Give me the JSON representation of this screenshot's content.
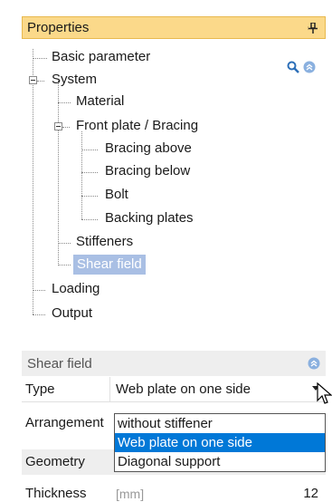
{
  "panel": {
    "title": "Properties",
    "pin_icon": "pin-icon"
  },
  "toolbar": {
    "search_icon": "search-icon",
    "collapse_icon": "collapse-up-icon"
  },
  "tree": {
    "basic_parameter": "Basic parameter",
    "system": "System",
    "material": "Material",
    "front_plate": "Front plate / Bracing",
    "bracing_above": "Bracing above",
    "bracing_below": "Bracing below",
    "bolt": "Bolt",
    "backing_plates": "Backing plates",
    "stiffeners": "Stiffeners",
    "shear_field": "Shear field",
    "loading": "Loading",
    "output": "Output"
  },
  "grid": {
    "section_title": "Shear field",
    "type_label": "Type",
    "type_value": "Web plate on one side",
    "arrangement_label": "Arrangement",
    "geometry_label": "Geometry",
    "thickness_label": "Thickness",
    "thickness_unit": "[mm]",
    "thickness_value": "12"
  },
  "dropdown": {
    "options": [
      "without stiffener",
      "Web plate on one side",
      "Diagonal support"
    ],
    "selected": "Web plate on one side"
  },
  "colors": {
    "header_bg": "#fbd98a",
    "selection_tree": "#a9bfe4",
    "selection_list": "#0078d7"
  }
}
